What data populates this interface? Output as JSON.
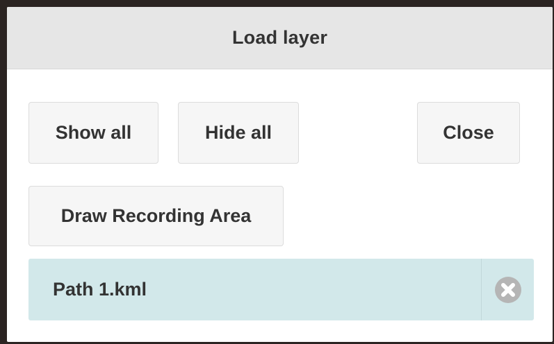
{
  "dialog": {
    "title": "Load layer"
  },
  "buttons": {
    "show_all": "Show all",
    "hide_all": "Hide all",
    "close": "Close",
    "draw_recording_area": "Draw Recording Area"
  },
  "layers": [
    {
      "name": "Path 1.kml",
      "remove_icon": "close-circle-icon"
    }
  ],
  "colors": {
    "header_bg": "#e6e6e6",
    "button_bg": "#f6f6f6",
    "layer_bg": "#d2e8ea",
    "icon": "#b5b5b5",
    "text": "#333333"
  }
}
